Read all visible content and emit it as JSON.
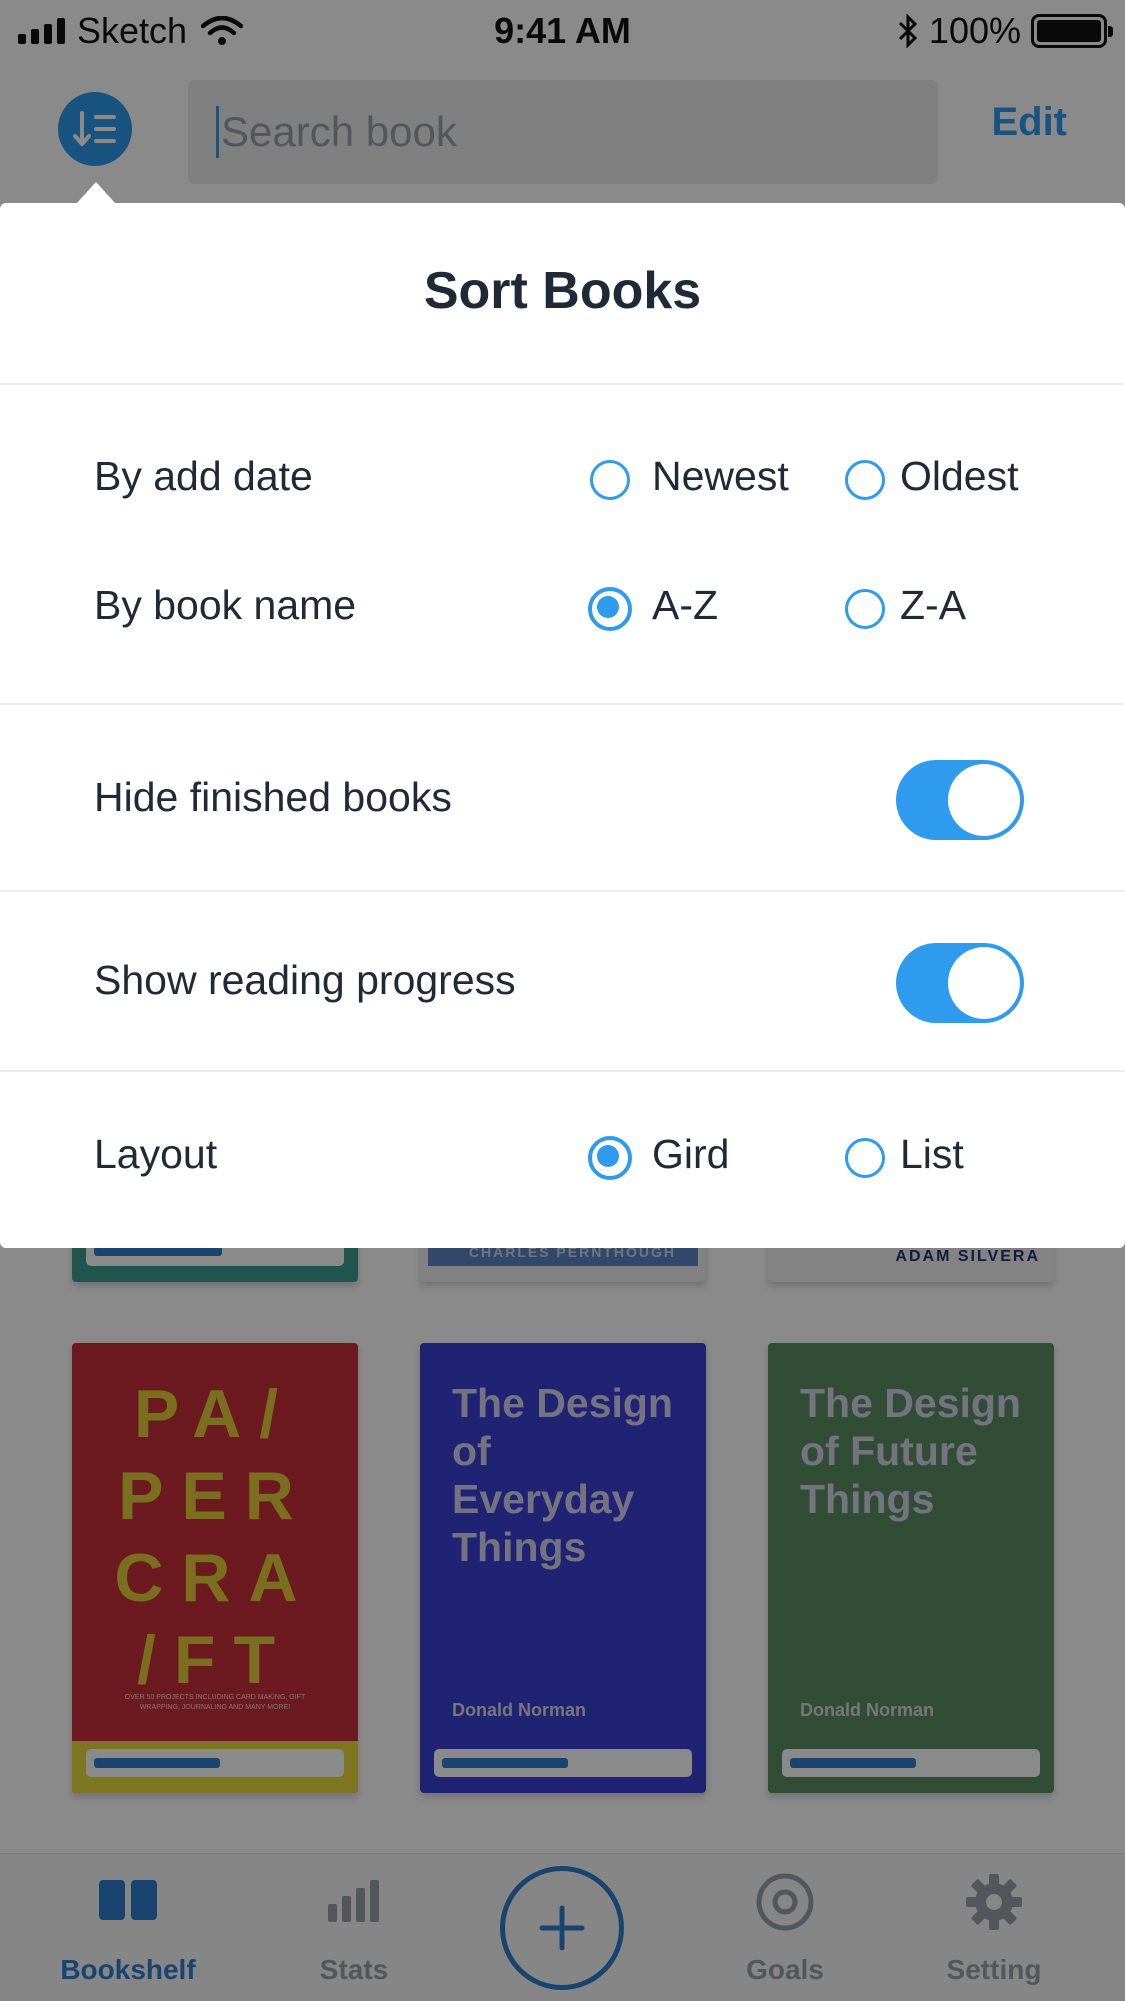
{
  "status_bar": {
    "carrier": "Sketch",
    "time": "9:41 AM",
    "battery": "100%",
    "icons": [
      "signal-icon",
      "wifi-icon",
      "bluetooth-icon",
      "battery-icon"
    ]
  },
  "header": {
    "search_placeholder": "Search book",
    "edit_label": "Edit",
    "sort_icon": "sort-icon"
  },
  "books": [
    {
      "title": "PA/ PER CRA /FT",
      "subtitle": "OVER 50 PROJECTS INCLUDING CARD MAKING, GIFT WRAPPING, JOURNALING AND MANY MORE!",
      "cover_color": "#c8313a",
      "progress": 0.52
    },
    {
      "title": "The Design of Everyday Things",
      "author": "Donald Norman",
      "cover_color": "#3b3fd6",
      "progress": 0.52
    },
    {
      "title": "The Design of Future Things",
      "author": "Donald Norman",
      "cover_color": "#5d8f64",
      "progress": 0.52
    }
  ],
  "partial_books": [
    {
      "text": "",
      "cover_color": "#3a9e8c"
    },
    {
      "text": "CHARLES PERNTHOUGH",
      "cover_color": "#5d86c4"
    },
    {
      "text": "ADAM SILVERA",
      "cover_color": "#f2f2f2"
    }
  ],
  "sort_popover": {
    "title": "Sort Books",
    "rows": {
      "add_date": {
        "label": "By add date",
        "options": [
          "Newest",
          "Oldest"
        ],
        "selected": null
      },
      "book_name": {
        "label": "By book name",
        "options": [
          "A-Z",
          "Z-A"
        ],
        "selected": "A-Z"
      },
      "hide_finished": {
        "label": "Hide finished books",
        "on": true
      },
      "show_progress": {
        "label": "Show reading progress",
        "on": true
      },
      "layout": {
        "label": "Layout",
        "options": [
          "Gird",
          "List"
        ],
        "selected": "Gird"
      }
    }
  },
  "tabbar": {
    "tabs": [
      {
        "label": "Bookshelf",
        "icon": "bookshelf-icon",
        "active": true
      },
      {
        "label": "Stats",
        "icon": "stats-icon",
        "active": false
      },
      {
        "label": "Goals",
        "icon": "goals-icon",
        "active": false
      },
      {
        "label": "Setting",
        "icon": "gear-icon",
        "active": false
      }
    ],
    "add_icon": "plus-icon"
  },
  "colors": {
    "accent": "#2f9bef",
    "tab_active": "#2f7fd0",
    "text": "#1f2a36"
  }
}
